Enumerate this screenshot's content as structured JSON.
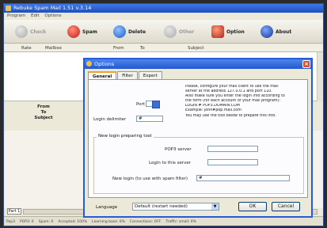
{
  "window": {
    "title": "Rebuke Spam Mail 1.51 v.3.14"
  },
  "menubar": [
    "Program",
    "Edit",
    "Options"
  ],
  "toolbar": {
    "buttons": [
      {
        "label": "Check",
        "disabled": true
      },
      {
        "label": "Spam",
        "disabled": false
      },
      {
        "label": "Delete",
        "disabled": false
      },
      {
        "label": "Other",
        "disabled": true
      },
      {
        "label": "Option",
        "disabled": false
      },
      {
        "label": "About",
        "disabled": false
      }
    ]
  },
  "columns": [
    "Rate",
    "Mailbox",
    "From",
    "To",
    "Subject"
  ],
  "preview": {
    "from": "From",
    "to": "To",
    "subject": "Subject"
  },
  "tab_part": "Part 1",
  "status": [
    "Pop3",
    "POP3: 0",
    "Spam: 0",
    "Accepted: 100%",
    "Learning base: 0%",
    "Connections: OFF",
    "Traffic: small: 0%"
  ],
  "dialog": {
    "title": "Options",
    "tabs": [
      "General",
      "Filter",
      "Expert"
    ],
    "port_label": "Port",
    "port_value": "",
    "delim_label": "Login delimiter",
    "delim_value": "#",
    "info_lines": [
      "Please, configure your mail client to use the mail",
      "server at the address 127.0.0.1 and port 110.",
      "Also make sure you enter the login info according to",
      "the form (for each account of your mail program):",
      "LOGIN # POP3.DOMAIN.COM",
      "Example: john#pop.mail.com",
      "You may use the tool below to prepare this info."
    ],
    "group_title": "New login preparing tool",
    "pop3_label": "POP3 server",
    "pop3_value": "",
    "login_label": "Login to this server",
    "login_value": "",
    "newlogin_label": "New login (to use with spam filter)",
    "newlogin_value": "#",
    "language_label": "Language",
    "language_value": "Default (restart needed)",
    "ok_label": "OK",
    "cancel_label": "Cancel"
  }
}
